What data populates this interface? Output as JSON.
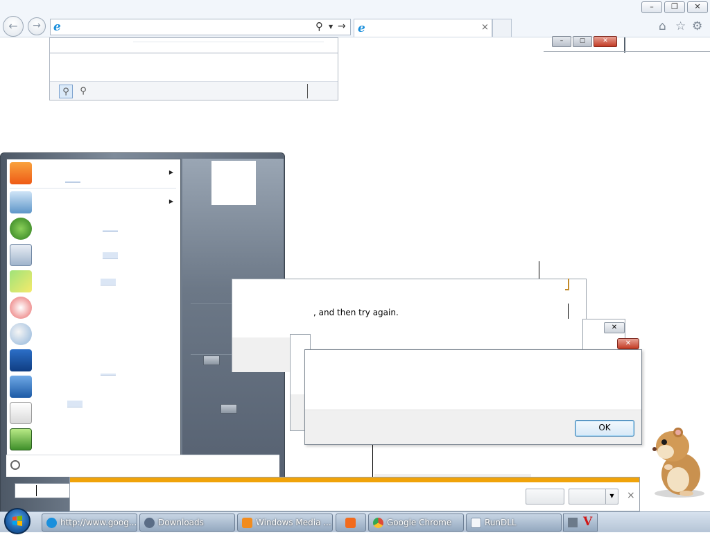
{
  "browser": {
    "address_value": "",
    "tab1_title": "",
    "nav": {
      "back_glyph": "←",
      "forward_glyph": "→"
    },
    "search_glyph": "⚲",
    "go_glyph": "→",
    "tab_close_glyph": "×",
    "window_controls": {
      "minimize": "–",
      "restore": "❐",
      "close": "✕"
    },
    "tools": {
      "home": "⌂",
      "favorites": "☆",
      "settings": "⚙"
    }
  },
  "start_menu": {
    "programs": [
      {
        "name": "uc-browser"
      },
      {
        "name": "getting-started"
      },
      {
        "name": "windows-media-center"
      },
      {
        "name": "calculator"
      },
      {
        "name": "sticky-notes"
      },
      {
        "name": "snipping-tool"
      },
      {
        "name": "paint"
      },
      {
        "name": "remote-desktop"
      },
      {
        "name": "magnifier"
      },
      {
        "name": "solitaire"
      },
      {
        "name": "notepad-plus-plus"
      }
    ]
  },
  "dialogs": {
    "error_message": ", and then try again.",
    "ok_label": "OK",
    "close_glyph": "✕"
  },
  "notification": {
    "close_glyph": "×",
    "dropdown_glyph": "▼"
  },
  "taskbar": {
    "items": [
      {
        "label": "http://www.goog...",
        "icon": "ie-icon",
        "color": "#1a8fdc"
      },
      {
        "label": "Downloads",
        "icon": "downloads-icon",
        "color": "#5a6d86"
      },
      {
        "label": "Windows Media ...",
        "icon": "media-player-icon",
        "color": "#f28c1e"
      },
      {
        "label": "",
        "icon": "uc-browser-icon",
        "color": "#f26b1d"
      },
      {
        "label": "Google Chrome",
        "icon": "chrome-icon",
        "color": "#dd4b39"
      },
      {
        "label": "RunDLL",
        "icon": "rundll-icon",
        "color": "#7a8fa8"
      }
    ]
  },
  "colors": {
    "notification_stripe": "#f0a30a",
    "ok_button_border": "#3c7fb1",
    "close_red": "#c23a23"
  }
}
